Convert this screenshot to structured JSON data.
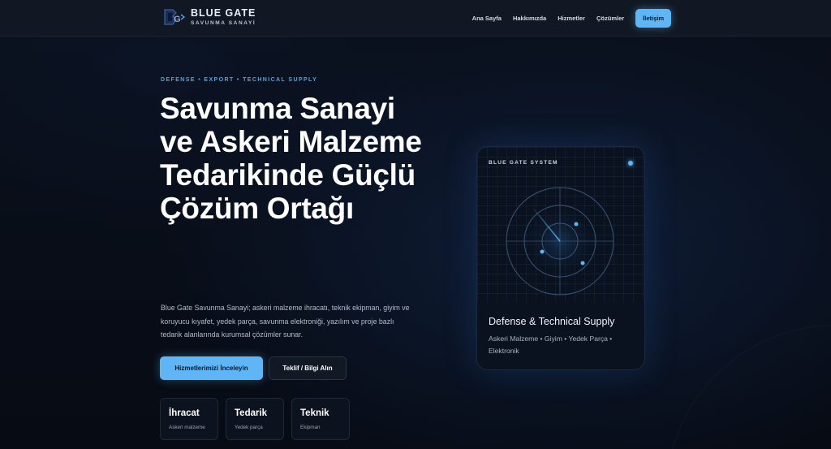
{
  "header": {
    "brand": "BLUE GATE",
    "brand_sub": "SAVUNMA SANAYİ",
    "nav": [
      "Ana Sayfa",
      "Hakkımızda",
      "Hizmetler",
      "Çözümler"
    ],
    "cta": "İletişim"
  },
  "hero": {
    "eyebrow": "DEFENSE • EXPORT • TECHNICAL SUPPLY",
    "title": "Savunma Sanayi ve Askeri Malzeme Tedarikinde Güçlü Çözüm Ortağı",
    "description": "Blue Gate Savunma Sanayi; askeri malzeme ihracatı, teknik ekipman, giyim ve koruyucu kıyafet, yedek parça, savunma elektroniği, yazılım ve proje bazlı tedarik alanlarında kurumsal çözümler sunar.",
    "primary_button": "Hizmetlerimizi İnceleyin",
    "secondary_button": "Teklif / Bilgi Alın",
    "stats": [
      {
        "title": "İhracat",
        "sub": "Askeri malzeme"
      },
      {
        "title": "Tedarik",
        "sub": "Yedek parça"
      },
      {
        "title": "Teknik",
        "sub": "Ekipman"
      }
    ]
  },
  "card": {
    "label": "BLUE GATE SYSTEM",
    "title": "Defense & Technical Supply",
    "subtitle": "Askeri Malzeme • Giyim • Yedek Parça • Elektronik"
  },
  "colors": {
    "accent": "#5fb6f7",
    "background": "#070b14",
    "eyebrow": "#4fa3e8"
  }
}
